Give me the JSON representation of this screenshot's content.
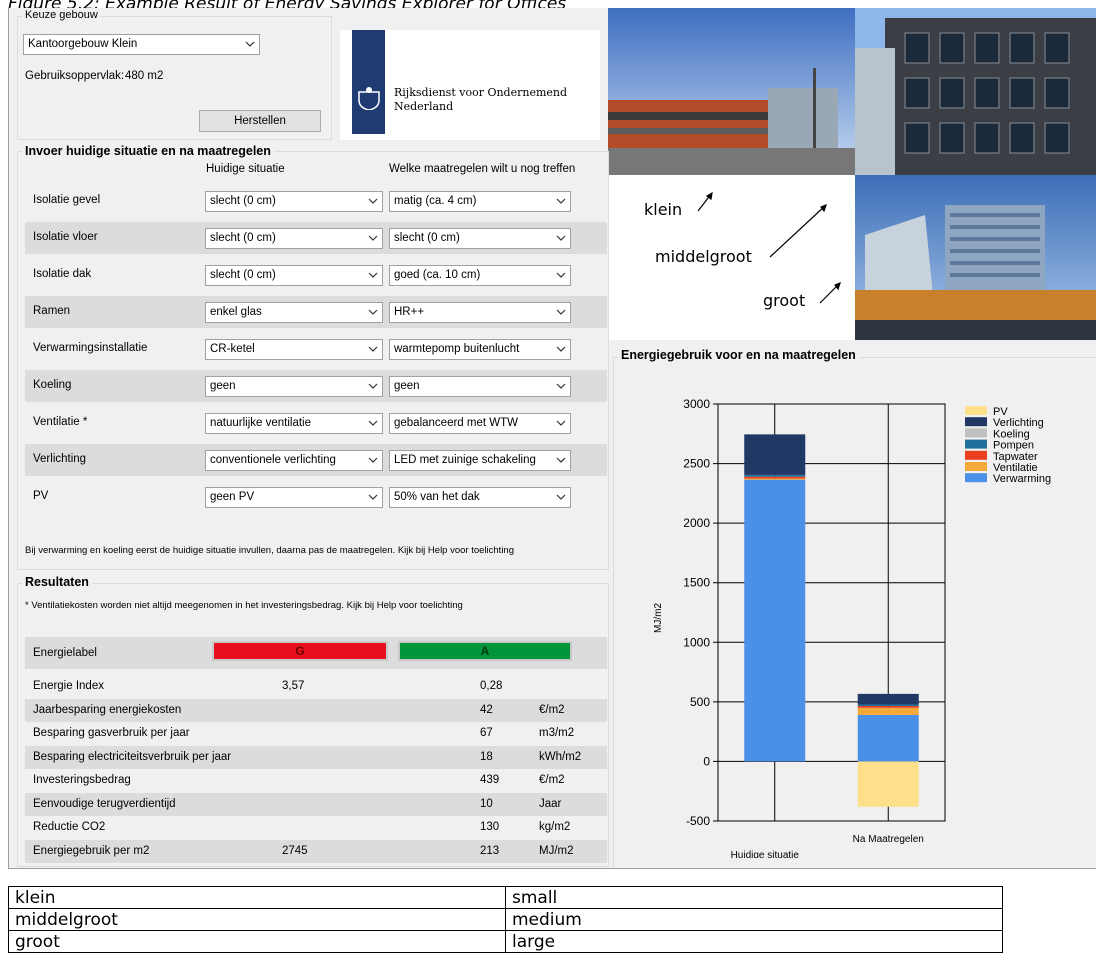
{
  "caption": "Figure 5.2: Example Result of Energy Savings Explorer for Offices",
  "building": {
    "group_title": "Keuze gebouw",
    "selected": "Kantoorgebouw Klein",
    "area_label": "Gebruiksoppervlak:",
    "area_value": "480 m2",
    "reset_button": "Herstellen"
  },
  "logo": {
    "line1": "Rijksdienst voor Ondernemend",
    "line2": "Nederland"
  },
  "photos": {
    "labels": [
      "klein",
      "middelgroot",
      "groot"
    ]
  },
  "input": {
    "group_title": "Invoer huidige situatie en na maatregelen",
    "col_current": "Huidige situatie",
    "col_measures": "Welke maatregelen wilt u nog treffen",
    "rows": [
      {
        "label": "Isolatie gevel",
        "current": "slecht (0 cm)",
        "measure": "matig (ca. 4 cm)"
      },
      {
        "label": "Isolatie vloer",
        "current": "slecht (0 cm)",
        "measure": "slecht (0 cm)"
      },
      {
        "label": "Isolatie dak",
        "current": "slecht (0 cm)",
        "measure": "goed (ca. 10 cm)"
      },
      {
        "label": "Ramen",
        "current": "enkel glas",
        "measure": "HR++"
      },
      {
        "label": "Verwarmingsinstallatie",
        "current": "CR-ketel",
        "measure": "warmtepomp buitenlucht"
      },
      {
        "label": "Koeling",
        "current": "geen",
        "measure": "geen"
      },
      {
        "label": "Ventilatie *",
        "current": "natuurlijke ventilatie",
        "measure": "gebalanceerd met WTW"
      },
      {
        "label": "Verlichting",
        "current": "conventionele verlichting",
        "measure": "LED met zuinige schakeling"
      },
      {
        "label": "PV",
        "current": "geen PV",
        "measure": "50% van het dak"
      }
    ],
    "note": "Bij verwarming en koeling eerst de huidige situatie invullen, daarna pas de maatregelen. Kijk bij Help voor toelichting"
  },
  "results": {
    "group_title": "Resultaten",
    "note": "* Ventilatiekosten worden niet altijd meegenomen in het investeringsbedrag. Kijk bij Help voor toelichting",
    "label_row": {
      "label": "Energielabel",
      "current": "G",
      "after": "A",
      "current_color": "#e8101c",
      "after_color": "#00953a"
    },
    "rows": [
      {
        "label": "Energie Index",
        "current": "3,57",
        "after": "0,28",
        "unit": ""
      },
      {
        "label": "Jaarbesparing energiekosten",
        "current": "",
        "after": "42",
        "unit": "€/m2"
      },
      {
        "label": "Besparing gasverbruik per jaar",
        "current": "",
        "after": "67",
        "unit": "m3/m2"
      },
      {
        "label": "Besparing electriciteitsverbruik per jaar",
        "current": "",
        "after": "18",
        "unit": "kWh/m2"
      },
      {
        "label": "Investeringsbedrag",
        "current": "",
        "after": "439",
        "unit": "€/m2"
      },
      {
        "label": "Eenvoudige terugverdientijd",
        "current": "",
        "after": "10",
        "unit": "Jaar"
      },
      {
        "label": "Reductie CO2",
        "current": "",
        "after": "130",
        "unit": "kg/m2"
      },
      {
        "label": "Energiegebruik per m2",
        "current": "2745",
        "after": "213",
        "unit": "MJ/m2"
      }
    ]
  },
  "chart_data": {
    "type": "bar",
    "stacked": true,
    "title": "Energiegebruik voor en na maatregelen",
    "ylabel": "MJ/m2",
    "ylim": [
      -500,
      3000
    ],
    "yticks": [
      -500,
      0,
      500,
      1000,
      1500,
      2000,
      2500,
      3000
    ],
    "categories": [
      "Huidige situatie",
      "Na Maatregelen"
    ],
    "series": [
      {
        "name": "PV",
        "color": "#ffe08a",
        "values": [
          0,
          -380
        ]
      },
      {
        "name": "Verlichting",
        "color": "#1f3864",
        "values": [
          340,
          90
        ]
      },
      {
        "name": "Koeling",
        "color": "#bfbfbf",
        "values": [
          0,
          0
        ]
      },
      {
        "name": "Pompen",
        "color": "#1f6f9a",
        "values": [
          15,
          12
        ]
      },
      {
        "name": "Tapwater",
        "color": "#e8401c",
        "values": [
          15,
          15
        ]
      },
      {
        "name": "Ventilatie",
        "color": "#f4a93a",
        "values": [
          10,
          60
        ]
      },
      {
        "name": "Verwarming",
        "color": "#4a90e8",
        "values": [
          2365,
          390
        ]
      }
    ],
    "legend_position": "top-right"
  },
  "translation_table": [
    [
      "klein",
      "small"
    ],
    [
      "middelgroot",
      "medium"
    ],
    [
      "groot",
      "large"
    ]
  ]
}
